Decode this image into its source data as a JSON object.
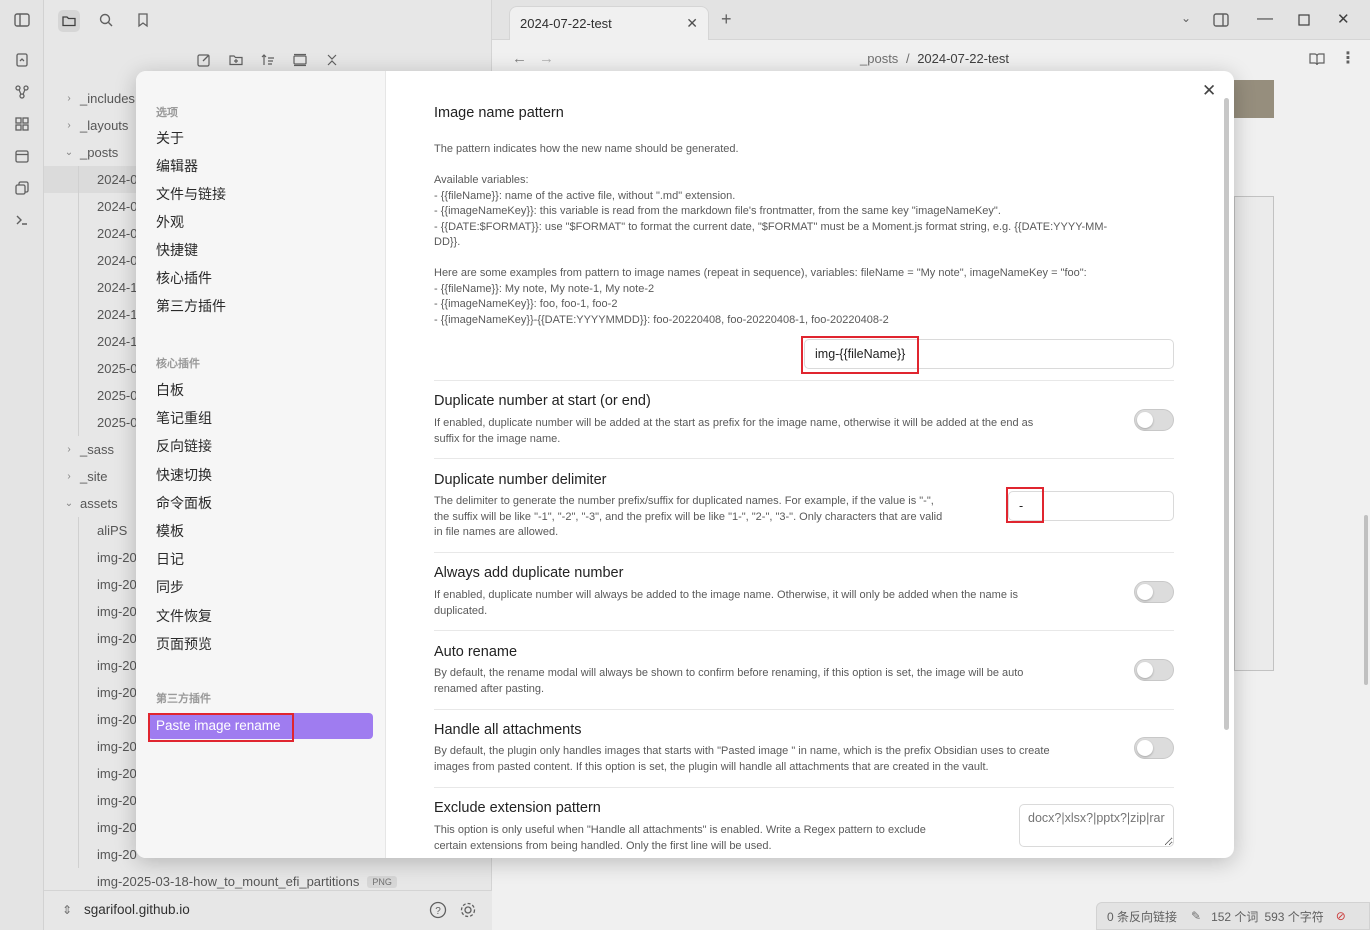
{
  "tab": {
    "title": "2024-07-22-test"
  },
  "breadcrumb": {
    "folder": "_posts",
    "sep": "/",
    "file": "2024-07-22-test"
  },
  "file_tree": {
    "items": [
      {
        "label": "_includes",
        "expanded": false,
        "indent": 0
      },
      {
        "label": "_layouts",
        "expanded": false,
        "indent": 0
      },
      {
        "label": "_posts",
        "expanded": true,
        "indent": 0
      },
      {
        "label": "2024-0",
        "indent": 1,
        "active": true
      },
      {
        "label": "2024-0",
        "indent": 1
      },
      {
        "label": "2024-0",
        "indent": 1
      },
      {
        "label": "2024-0",
        "indent": 1
      },
      {
        "label": "2024-1",
        "indent": 1
      },
      {
        "label": "2024-1",
        "indent": 1
      },
      {
        "label": "2024-1",
        "indent": 1
      },
      {
        "label": "2025-0",
        "indent": 1
      },
      {
        "label": "2025-0",
        "indent": 1
      },
      {
        "label": "2025-0",
        "indent": 1
      },
      {
        "label": "_sass",
        "expanded": false,
        "indent": 0
      },
      {
        "label": "_site",
        "expanded": false,
        "indent": 0
      },
      {
        "label": "assets",
        "expanded": true,
        "indent": 0
      },
      {
        "label": "aliPS",
        "indent": 1
      },
      {
        "label": "img-20",
        "indent": 1
      },
      {
        "label": "img-20",
        "indent": 1
      },
      {
        "label": "img-20",
        "indent": 1
      },
      {
        "label": "img-20",
        "indent": 1
      },
      {
        "label": "img-20",
        "indent": 1
      },
      {
        "label": "img-20",
        "indent": 1
      },
      {
        "label": "img-20",
        "indent": 1
      },
      {
        "label": "img-20",
        "indent": 1
      },
      {
        "label": "img-20",
        "indent": 1
      },
      {
        "label": "img-20",
        "indent": 1
      },
      {
        "label": "img-20",
        "indent": 1
      },
      {
        "label": "img-20",
        "indent": 1
      }
    ],
    "last_file": {
      "label": "img-2025-03-18-how_to_mount_efi_partitions",
      "badge": "PNG"
    }
  },
  "vault": {
    "name": "sgarifool.github.io"
  },
  "status": {
    "backlinks": "0 条反向链接",
    "words": "152 个词",
    "chars": "593 个字符"
  },
  "settings_nav": {
    "section1": "选项",
    "items1": [
      "关于",
      "编辑器",
      "文件与链接",
      "外观",
      "快捷键",
      "核心插件",
      "第三方插件"
    ],
    "section2": "核心插件",
    "items2": [
      "白板",
      "笔记重组",
      "反向链接",
      "快速切换",
      "命令面板",
      "模板",
      "日记",
      "同步",
      "文件恢复",
      "页面预览"
    ],
    "section3": "第三方插件",
    "active": "Paste image rename"
  },
  "settings": {
    "pattern": {
      "title": "Image name pattern",
      "desc": [
        "The pattern indicates how the new name should be generated.",
        "",
        "Available variables:",
        "- {{fileName}}: name of the active file, without \".md\" extension.",
        "- {{imageNameKey}}: this variable is read from the markdown file's frontmatter, from the same key \"imageNameKey\".",
        "- {{DATE:$FORMAT}}: use \"$FORMAT\" to format the current date, \"$FORMAT\" must be a Moment.js format string, e.g. {{DATE:YYYY-MM-",
        "DD}}.",
        "",
        "Here are some examples from pattern to image names (repeat in sequence), variables: fileName = \"My note\", imageNameKey = \"foo\":",
        "- {{fileName}}: My note, My note-1, My note-2",
        "- {{imageNameKey}}: foo, foo-1, foo-2",
        "- {{imageNameKey}}-{{DATE:YYYYMMDD}}: foo-20220408, foo-20220408-1, foo-20220408-2"
      ],
      "value": "img-{{fileName}}"
    },
    "dup_start": {
      "title": "Duplicate number at start (or end)",
      "desc": [
        "If enabled, duplicate number will be added at the start as prefix for the image name, otherwise it will be added at the end as",
        "suffix for the image name."
      ],
      "enabled": false
    },
    "dup_delim": {
      "title": "Duplicate number delimiter",
      "desc": [
        "The delimiter to generate the number prefix/suffix for duplicated names. For example, if the value is \"-\",",
        "the suffix will be like \"-1\", \"-2\", \"-3\", and the prefix will be like \"1-\", \"2-\", \"3-\". Only characters that are valid",
        "in file names are allowed."
      ],
      "value": "-"
    },
    "always_dup": {
      "title": "Always add duplicate number",
      "desc": [
        "If enabled, duplicate number will always be added to the image name. Otherwise, it will only be added when the name is",
        "duplicated."
      ],
      "enabled": false
    },
    "auto_rename": {
      "title": "Auto rename",
      "desc": [
        "By default, the rename modal will always be shown to confirm before renaming, if this option is set, the image will be auto",
        "renamed after pasting."
      ],
      "enabled": false
    },
    "handle_all": {
      "title": "Handle all attachments",
      "desc": [
        "By default, the plugin only handles images that starts with \"Pasted image \" in name, which is the prefix Obsidian uses to create",
        "images from pasted content. If this option is set, the plugin will handle all attachments that are created in the vault."
      ],
      "enabled": false
    },
    "exclude": {
      "title": "Exclude extension pattern",
      "desc": [
        "This option is only useful when \"Handle all attachments\" is enabled. Write a Regex pattern to exclude",
        "certain extensions from being handled. Only the first line will be used."
      ],
      "placeholder": "docx?|xlsx?|pptx?|zip|rar"
    }
  }
}
